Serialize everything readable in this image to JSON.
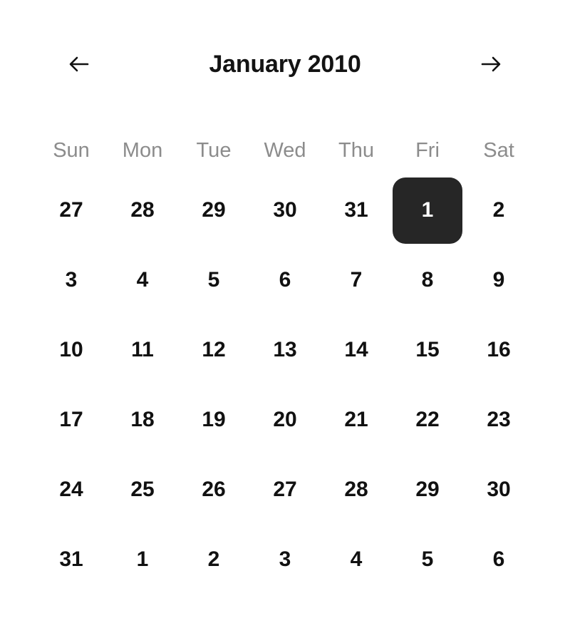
{
  "header": {
    "title": "January 2010",
    "prev_icon": "arrow-left-icon",
    "next_icon": "arrow-right-icon"
  },
  "weekdays": [
    "Sun",
    "Mon",
    "Tue",
    "Wed",
    "Thu",
    "Fri",
    "Sat"
  ],
  "colors": {
    "background": "#ffffff",
    "date_text": "#111111",
    "weekday_text": "#8c8c8c",
    "title_text": "#131313",
    "selected_background": "#262626",
    "selected_text": "#ffffff"
  },
  "selected_day": "1",
  "weeks": [
    [
      {
        "label": "27"
      },
      {
        "label": "28"
      },
      {
        "label": "29"
      },
      {
        "label": "30"
      },
      {
        "label": "31"
      },
      {
        "label": "1",
        "selected": true
      },
      {
        "label": "2"
      }
    ],
    [
      {
        "label": "3"
      },
      {
        "label": "4"
      },
      {
        "label": "5"
      },
      {
        "label": "6"
      },
      {
        "label": "7"
      },
      {
        "label": "8"
      },
      {
        "label": "9"
      }
    ],
    [
      {
        "label": "10"
      },
      {
        "label": "11"
      },
      {
        "label": "12"
      },
      {
        "label": "13"
      },
      {
        "label": "14"
      },
      {
        "label": "15"
      },
      {
        "label": "16"
      }
    ],
    [
      {
        "label": "17"
      },
      {
        "label": "18"
      },
      {
        "label": "19"
      },
      {
        "label": "20"
      },
      {
        "label": "21"
      },
      {
        "label": "22"
      },
      {
        "label": "23"
      }
    ],
    [
      {
        "label": "24"
      },
      {
        "label": "25"
      },
      {
        "label": "26"
      },
      {
        "label": "27"
      },
      {
        "label": "28"
      },
      {
        "label": "29"
      },
      {
        "label": "30"
      }
    ],
    [
      {
        "label": "31"
      },
      {
        "label": "1"
      },
      {
        "label": "2"
      },
      {
        "label": "3"
      },
      {
        "label": "4"
      },
      {
        "label": "5"
      },
      {
        "label": "6"
      }
    ]
  ]
}
